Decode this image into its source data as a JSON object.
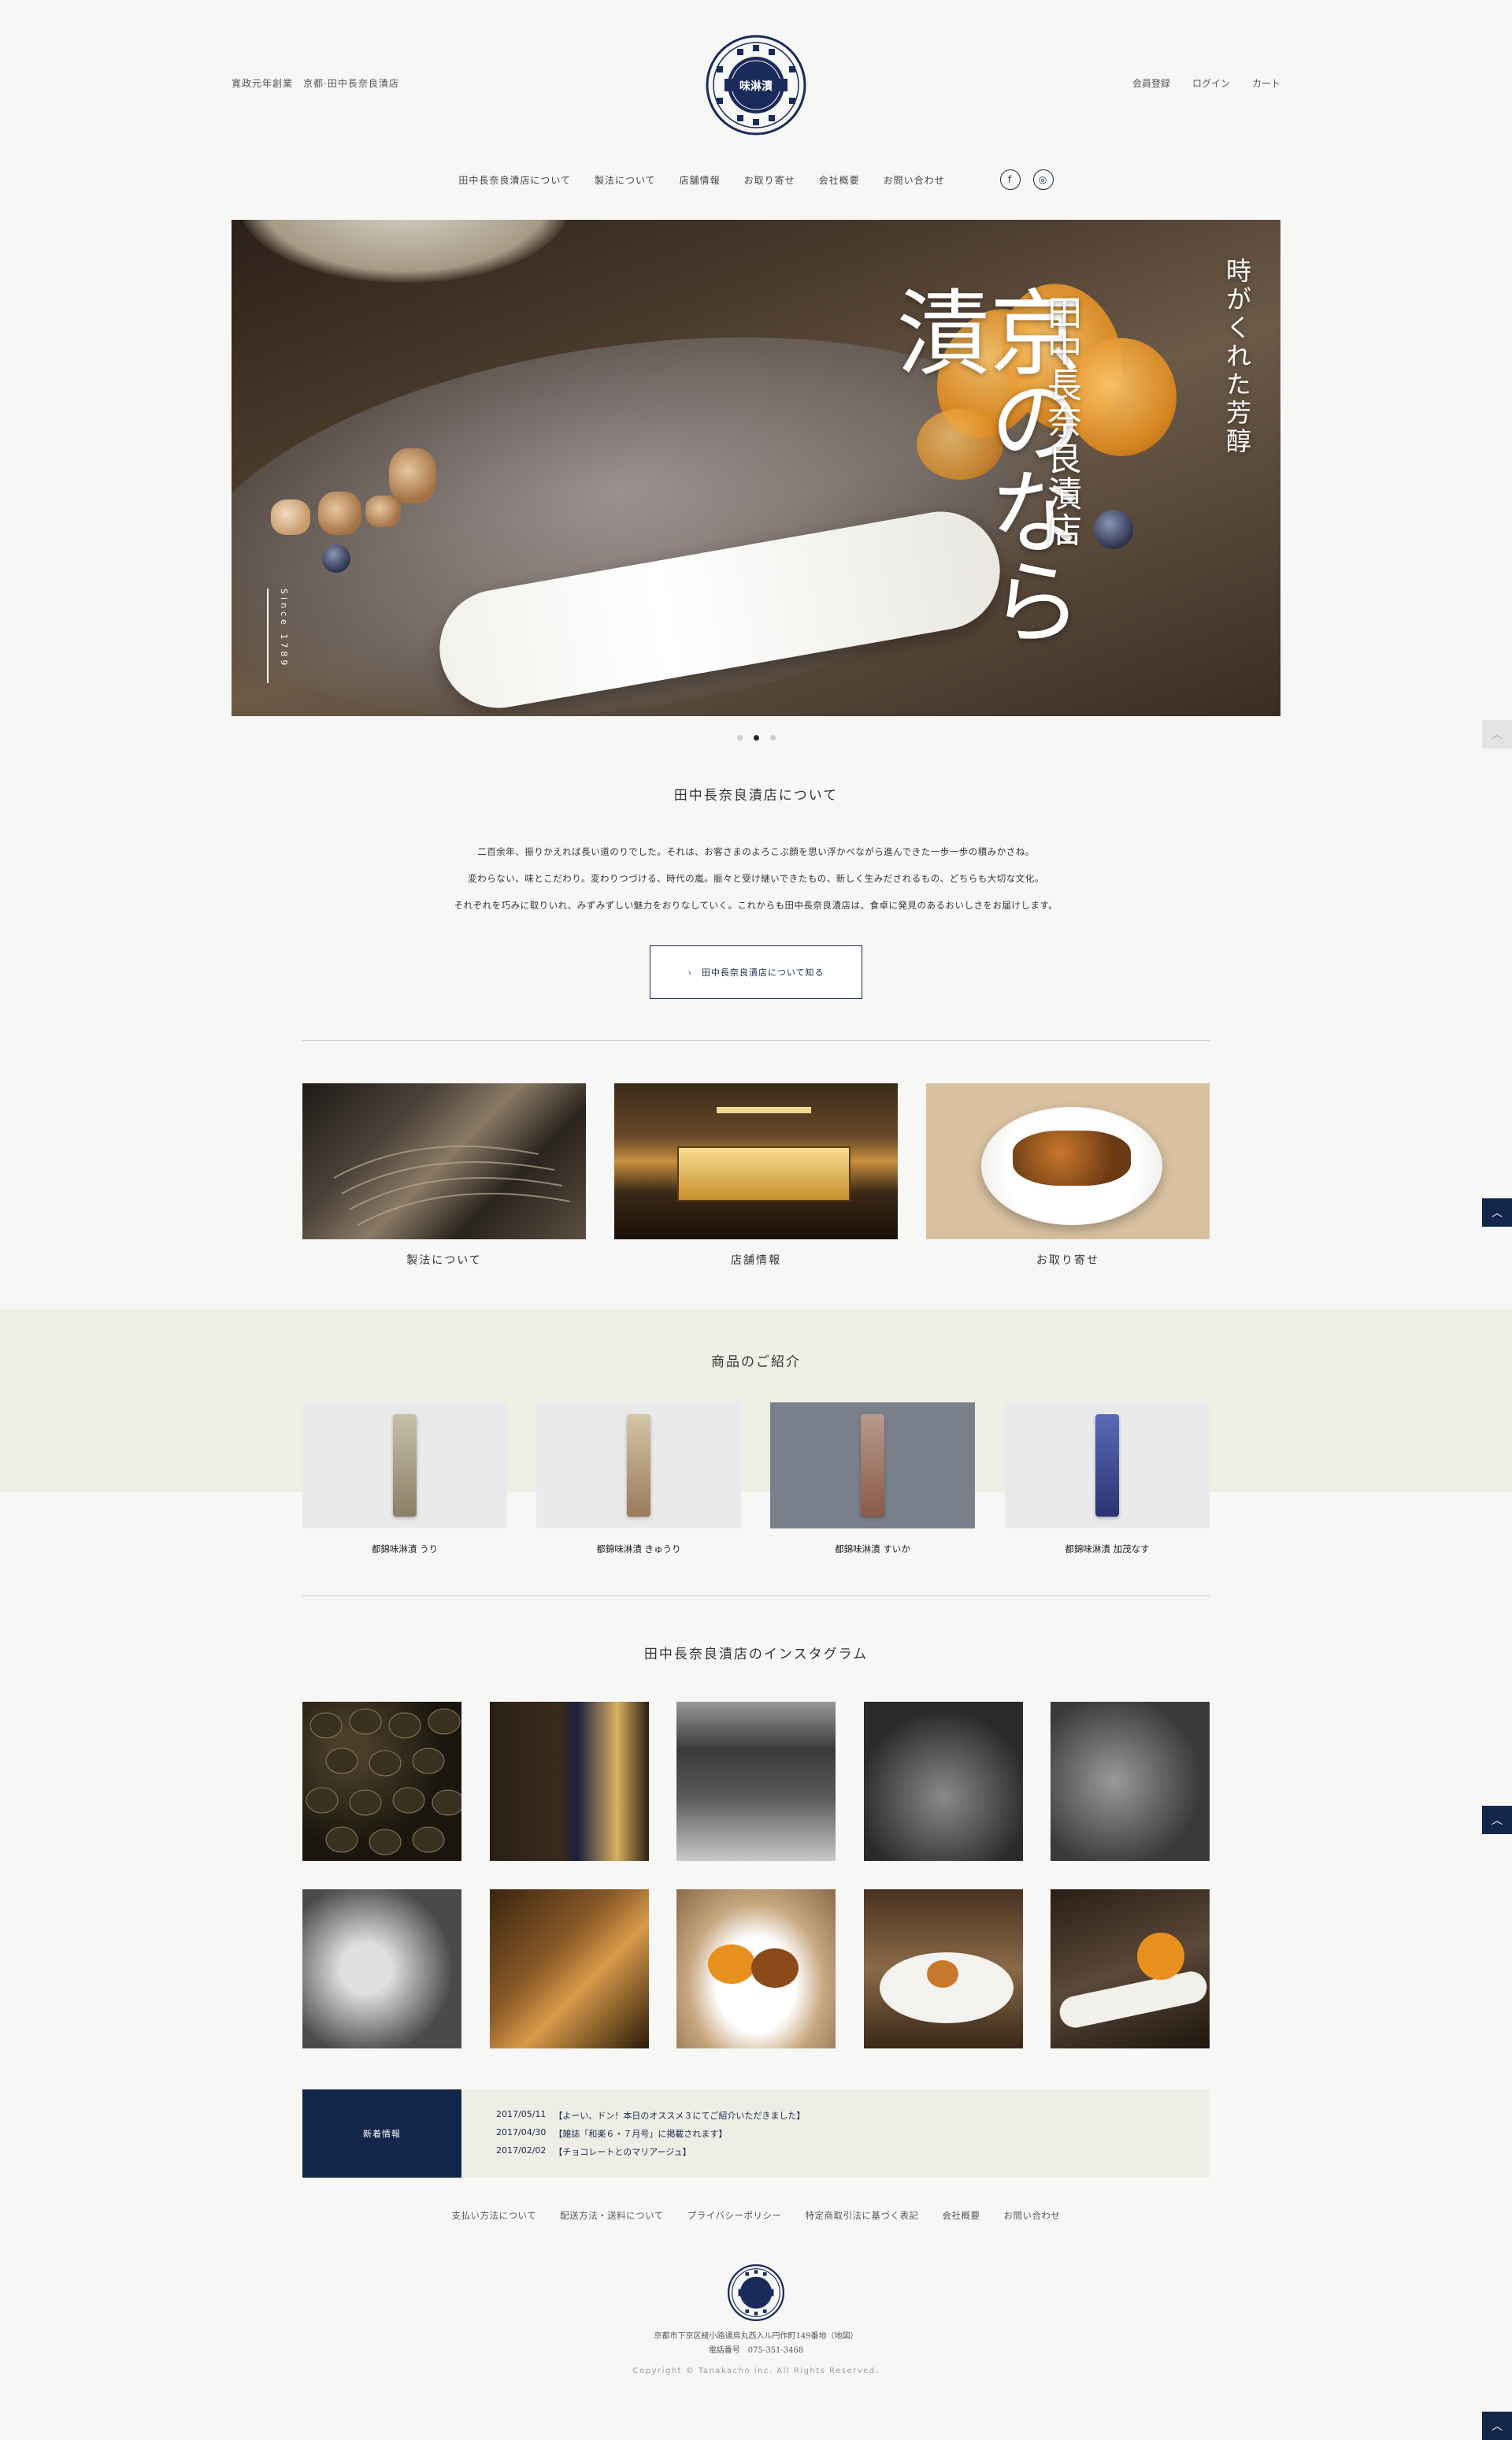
{
  "header": {
    "tagline": "寛政元年創業　京都·田中長奈良漬店",
    "logo_text": "味淋漬",
    "user_nav": [
      "会員登録",
      "ログイン",
      "カート"
    ]
  },
  "main_nav": [
    "田中長奈良漬店について",
    "製法について",
    "店舗情報",
    "お取り寄せ",
    "会社概要",
    "お問い合わせ"
  ],
  "social": {
    "facebook": "f",
    "instagram": "◎"
  },
  "hero": {
    "title": "京のなら漬",
    "shop_name": "田中長奈良漬店",
    "catch": "時がくれた芳醇",
    "since": "Since 1789",
    "slide_count": 3,
    "active_slide": 2
  },
  "about": {
    "title": "田中長奈良漬店について",
    "lines": [
      "二百余年、振りかえれば長い道のりでした。それは、お客さまのよろこぶ顔を思い浮かべながら進んできた一歩一歩の積みかさね。",
      "変わらない、味とこだわり。変わりつづける、時代の嵐。脈々と受け継いできたもの、新しく生みだされるもの、どちらも大切な文化。",
      "それぞれを巧みに取りいれ、みずみずしい魅力をおりなしていく。これからも田中長奈良漬店は、食卓に発見のあるおいしさをお届けします。"
    ],
    "button": "田中長奈良漬店について知る"
  },
  "features": [
    {
      "label": "製法について"
    },
    {
      "label": "店舗情報"
    },
    {
      "label": "お取り寄せ"
    }
  ],
  "products": {
    "title": "商品のご紹介",
    "items": [
      {
        "name": "都錦味淋漬 うり"
      },
      {
        "name": "都錦味淋漬 きゅうり"
      },
      {
        "name": "都錦味淋漬 すいか"
      },
      {
        "name": "都錦味淋漬 加茂なす"
      }
    ]
  },
  "instagram": {
    "title": "田中長奈良漬店のインスタグラム"
  },
  "news": {
    "label": "新着情報",
    "items": [
      {
        "date": "2017/05/11",
        "text": "【よーい、ドン！本日のオススメ３にてご紹介いただきました】"
      },
      {
        "date": "2017/04/30",
        "text": "【雑誌「和楽６・７月号」に掲載されます】"
      },
      {
        "date": "2017/02/02",
        "text": "【チョコレートとのマリアージュ】"
      }
    ]
  },
  "footer": {
    "nav": [
      "支払い方法について",
      "配送方法・送料について",
      "プライバシーポリシー",
      "特定商取引法に基づく表記",
      "会社概要",
      "お問い合わせ"
    ],
    "address": "京都市下京区綾小路通烏丸西入ル円作町149番地（地図）",
    "phone": "電話番号　075-351-3468",
    "copyright": "Copyright © Tanakacho inc. All Rights Reserved."
  },
  "colors": {
    "navy": "#14254a",
    "band": "#f0efe6",
    "background": "#f7f7f5"
  }
}
